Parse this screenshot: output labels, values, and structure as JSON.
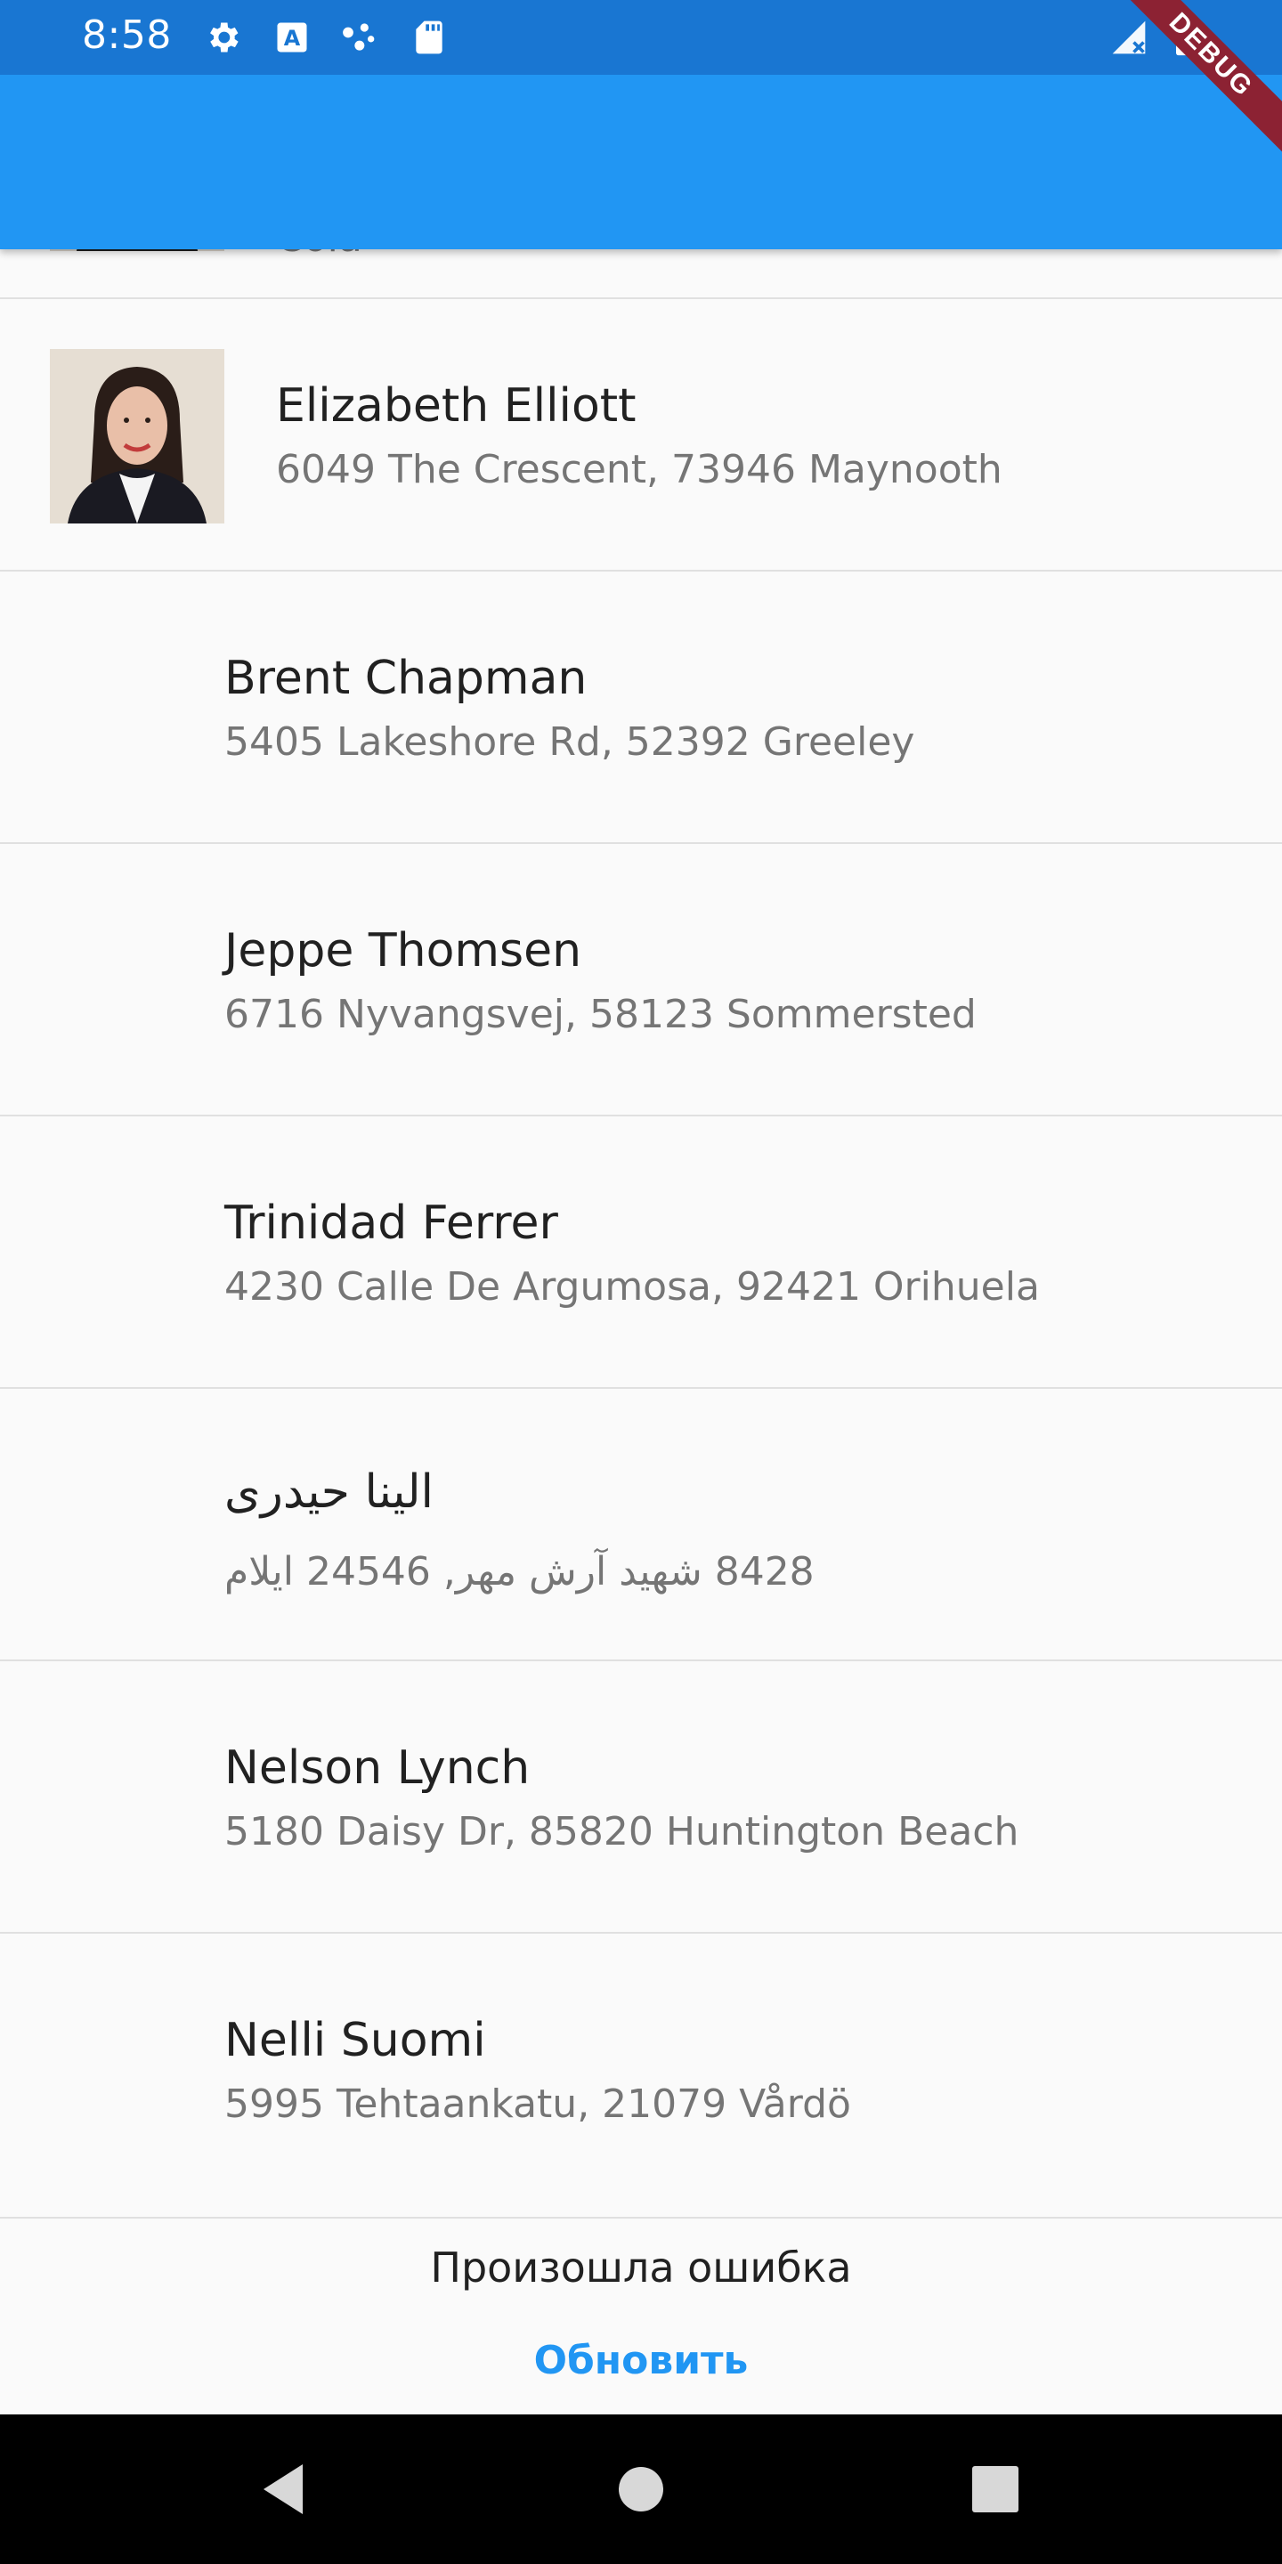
{
  "status_bar": {
    "time": "8:58",
    "icons": [
      "gear-icon",
      "a-text-icon",
      "dots-icon",
      "sd-card-icon",
      "signal-icon",
      "battery-icon"
    ]
  },
  "debug_banner": {
    "label": "DEBUG"
  },
  "colors": {
    "status_bar": "#1976d2",
    "app_bar": "#2196f3",
    "accent": "#2196f3",
    "banner": "#8c2233"
  },
  "list": {
    "items": [
      {
        "name": "",
        "address": "Cola",
        "has_avatar": true,
        "partial": true
      },
      {
        "name": "Elizabeth Elliott",
        "address": "6049 The Crescent, 73946 Maynooth",
        "has_avatar": true
      },
      {
        "name": "Brent Chapman",
        "address": "5405 Lakeshore Rd, 52392 Greeley",
        "has_avatar": false
      },
      {
        "name": "Jeppe Thomsen",
        "address": "6716 Nyvangsvej, 58123 Sommersted",
        "has_avatar": false
      },
      {
        "name": "Trinidad Ferrer",
        "address": "4230 Calle De Argumosa, 92421 Orihuela",
        "has_avatar": false
      },
      {
        "name": "الینا حیدری",
        "address": "8428 شهید آرش مهر, 24546 ایلام",
        "has_avatar": false
      },
      {
        "name": "Nelson Lynch",
        "address": "5180 Daisy Dr, 85820 Huntington Beach",
        "has_avatar": false
      },
      {
        "name": "Nelli Suomi",
        "address": "5995 Tehtaankatu, 21079 Vårdö",
        "has_avatar": false
      }
    ]
  },
  "error": {
    "message": "Произошла ошибка",
    "retry_label": "Обновить"
  },
  "nav_bar": {
    "buttons": [
      "back-icon",
      "home-icon",
      "recents-icon"
    ]
  }
}
